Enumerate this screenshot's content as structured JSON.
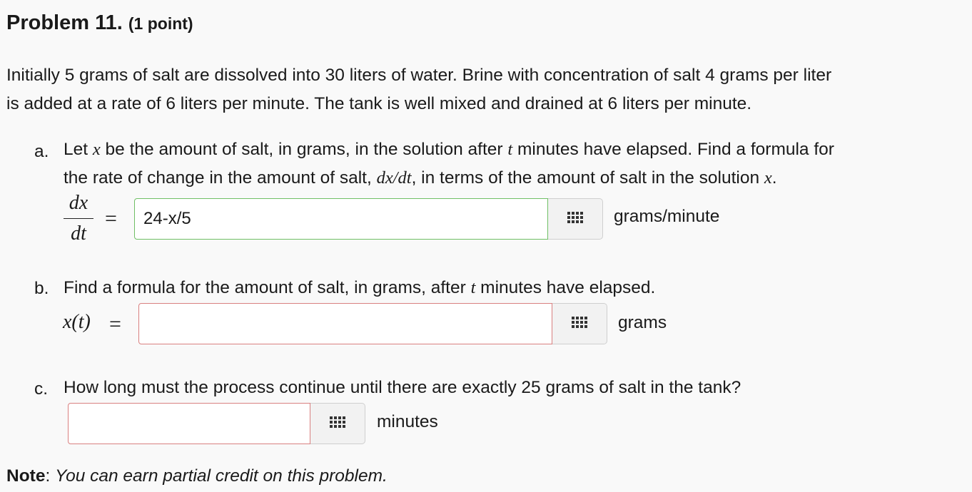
{
  "header": {
    "problem_label": "Problem 11.",
    "points": "(1 point)"
  },
  "intro": {
    "line1": "Initially 5 grams of salt are dissolved into 30 liters of water. Brine with concentration of salt 4 grams per liter",
    "line2": "is added at a rate of 6 liters per minute. The tank is well mixed and drained at 6 liters per minute."
  },
  "part_a": {
    "letter": "a.",
    "line1_pre": "Let ",
    "var_x": "x",
    "line1_mid": " be the amount of salt, in grams, in the solution after ",
    "var_t": "t",
    "line1_post": " minutes have elapsed. Find a formula for",
    "line2_pre": "the rate of change in the amount of salt, ",
    "deriv_inline": "dx/dt",
    "line2_mid": ", in terms of the amount of salt in the solution ",
    "var_x2": "x",
    "line2_post": ".",
    "frac_num": "dx",
    "frac_den": "dt",
    "equals": "=",
    "answer_value": "24-x/5",
    "answer_status": "correct",
    "unit": "grams/minute"
  },
  "part_b": {
    "letter": "b.",
    "text_pre": "Find a formula for the amount of salt, in grams, after ",
    "var_t": "t",
    "text_post": " minutes have elapsed.",
    "lhs": "x(t)",
    "equals": "=",
    "answer_value": "",
    "answer_status": "empty",
    "unit": "grams"
  },
  "part_c": {
    "letter": "c.",
    "text": "How long must the process continue until there are exactly 25 grams of salt in the tank?",
    "answer_value": "",
    "answer_status": "empty",
    "unit": "minutes"
  },
  "note": {
    "label": "Note",
    "colon": ":",
    "text": "You can earn partial credit on this problem."
  },
  "icons": {
    "palette": "equation-palette-grid-icon"
  },
  "colors": {
    "correct_border": "#6fbf65",
    "incorrect_border": "#d98080",
    "background": "#f9f9f9"
  }
}
